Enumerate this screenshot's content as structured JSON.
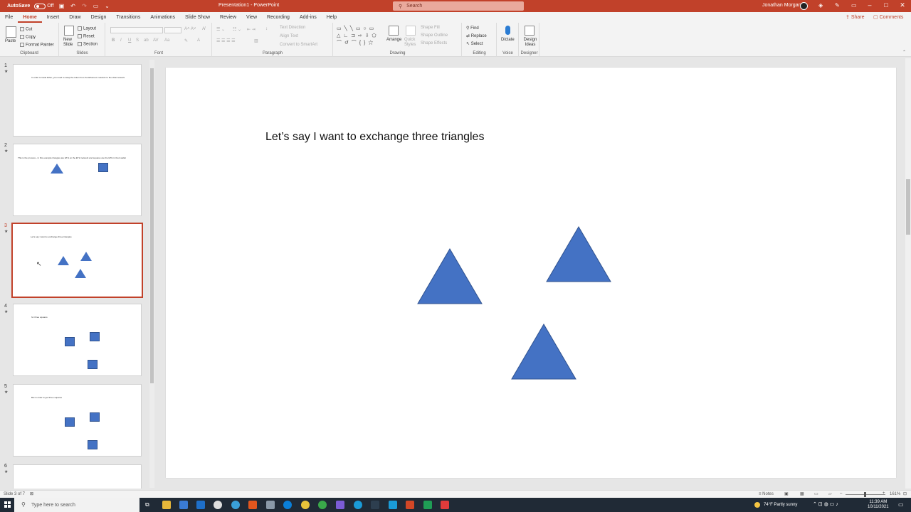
{
  "titlebar": {
    "autosave_label": "AutoSave",
    "autosave_state": "Off",
    "doc_title": "Presentation1 - PowerPoint",
    "search_placeholder": "Search",
    "user_name": "Jonathan Morgan"
  },
  "menu": {
    "tabs": [
      "File",
      "Home",
      "Insert",
      "Draw",
      "Design",
      "Transitions",
      "Animations",
      "Slide Show",
      "Review",
      "View",
      "Recording",
      "Add-ins",
      "Help"
    ],
    "active_tab": "Home",
    "share_label": "Share",
    "comments_label": "Comments"
  },
  "ribbon": {
    "clipboard": {
      "label": "Clipboard",
      "paste": "Paste",
      "cut": "Cut",
      "copy": "Copy",
      "format_painter": "Format Painter"
    },
    "slides": {
      "label": "Slides",
      "new_slide": "New Slide",
      "layout": "Layout",
      "reset": "Reset",
      "section": "Section"
    },
    "font": {
      "label": "Font"
    },
    "paragraph": {
      "label": "Paragraph",
      "text_direction": "Text Direction",
      "align_text": "Align Text",
      "convert_smartart": "Convert to SmartArt"
    },
    "drawing": {
      "label": "Drawing",
      "arrange": "Arrange",
      "quick_styles": "Quick Styles",
      "shape_fill": "Shape Fill",
      "shape_outline": "Shape Outline",
      "shape_effects": "Shape Effects"
    },
    "editing": {
      "label": "Editing",
      "find": "Find",
      "replace": "Replace",
      "select": "Select"
    },
    "voice": {
      "label": "Voice",
      "dictate": "Dictate"
    },
    "designer": {
      "label": "Designer",
      "design_ideas": "Design Ideas"
    }
  },
  "thumbnails": [
    {
      "num": "1",
      "text": "In order to trade Ether, you need to swap the token from the Ethereum network to the xDai network"
    },
    {
      "num": "2",
      "text": "This is the process - in this example triangles are ETH on the ETH network and squares are the ETH in their wallet"
    },
    {
      "num": "3",
      "text": "Let's say I want to exchange three triangles"
    },
    {
      "num": "4",
      "text": "for three squares"
    },
    {
      "num": "5",
      "text": "But in order to get three squares"
    },
    {
      "num": "6",
      "text": ""
    }
  ],
  "slide": {
    "title": "Let’s say I want to exchange three triangles"
  },
  "statusbar": {
    "slide_info": "Slide 3 of 7",
    "notes": "Notes",
    "zoom": "161%"
  },
  "taskbar": {
    "search_placeholder": "Type here to search",
    "weather": "74°F  Partly sunny",
    "time": "11:39 AM",
    "date": "10/11/2021"
  },
  "colors": {
    "accent": "#c1412a",
    "shape_fill": "#4472c4",
    "shape_outline": "#2f528f"
  }
}
